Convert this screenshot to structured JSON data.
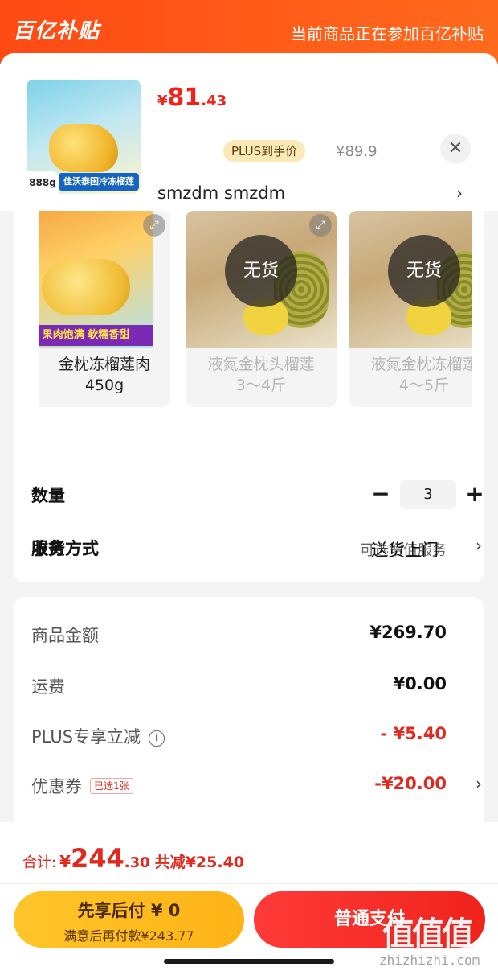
{
  "banner": {
    "logo": "百亿补贴",
    "note": "当前商品正在参加百亿补贴"
  },
  "product": {
    "thumb_weight": "888g",
    "thumb_title": "佳沃泰国冷冻榴莲",
    "price_currency": "¥",
    "price_int": "81",
    "price_dec": ".43",
    "plus_badge": "PLUS到手价",
    "original_price": "¥89.9",
    "close_symbol": "✕",
    "shop": "smzdm  smzdm"
  },
  "variants": [
    {
      "name": "金枕冻榴莲肉\n450g",
      "line1": "金枕冻榴莲肉",
      "line2": "450g",
      "in_stock": true,
      "banner": "果肉饱满 软糯香甜"
    },
    {
      "line1": "液氮金枕头榴莲",
      "line2": "3～4斤",
      "in_stock": false,
      "status": "无货"
    },
    {
      "line1": "液氮金枕冻榴莲",
      "line2": "4～5斤",
      "in_stock": false,
      "status": "无货"
    }
  ],
  "options": {
    "quantity_label": "数量",
    "quantity_value": "3",
    "minus_symbol": "−",
    "plus_symbol": "+",
    "service_label": "服务",
    "service_value": "可选增值服务",
    "delivery_label": "收货方式",
    "delivery_value": "送货上门"
  },
  "fees": {
    "goods_label": "商品金额",
    "goods_value": "¥269.70",
    "shipping_label": "运费",
    "shipping_value": "¥0.00",
    "plus_label": "PLUS专享立减",
    "plus_value": "- ¥5.40",
    "coupon_label": "优惠券",
    "coupon_tag": "已选1张",
    "coupon_value": "-¥20.00"
  },
  "total": {
    "label": "合计:",
    "currency": "¥",
    "int": "244",
    "dec": ".30",
    "saved": "共减¥25.40"
  },
  "actions": {
    "pay_later_title": "先享后付 ¥ 0",
    "pay_later_sub": "满意后再付款¥243.77",
    "pay_normal": "普通支付"
  },
  "watermark": {
    "url": "zhizhizhi.com"
  },
  "colors": {
    "brand_orange": "#ff4a14",
    "price_red": "#f0231b",
    "pay_later_yellow": "#ffb316"
  }
}
